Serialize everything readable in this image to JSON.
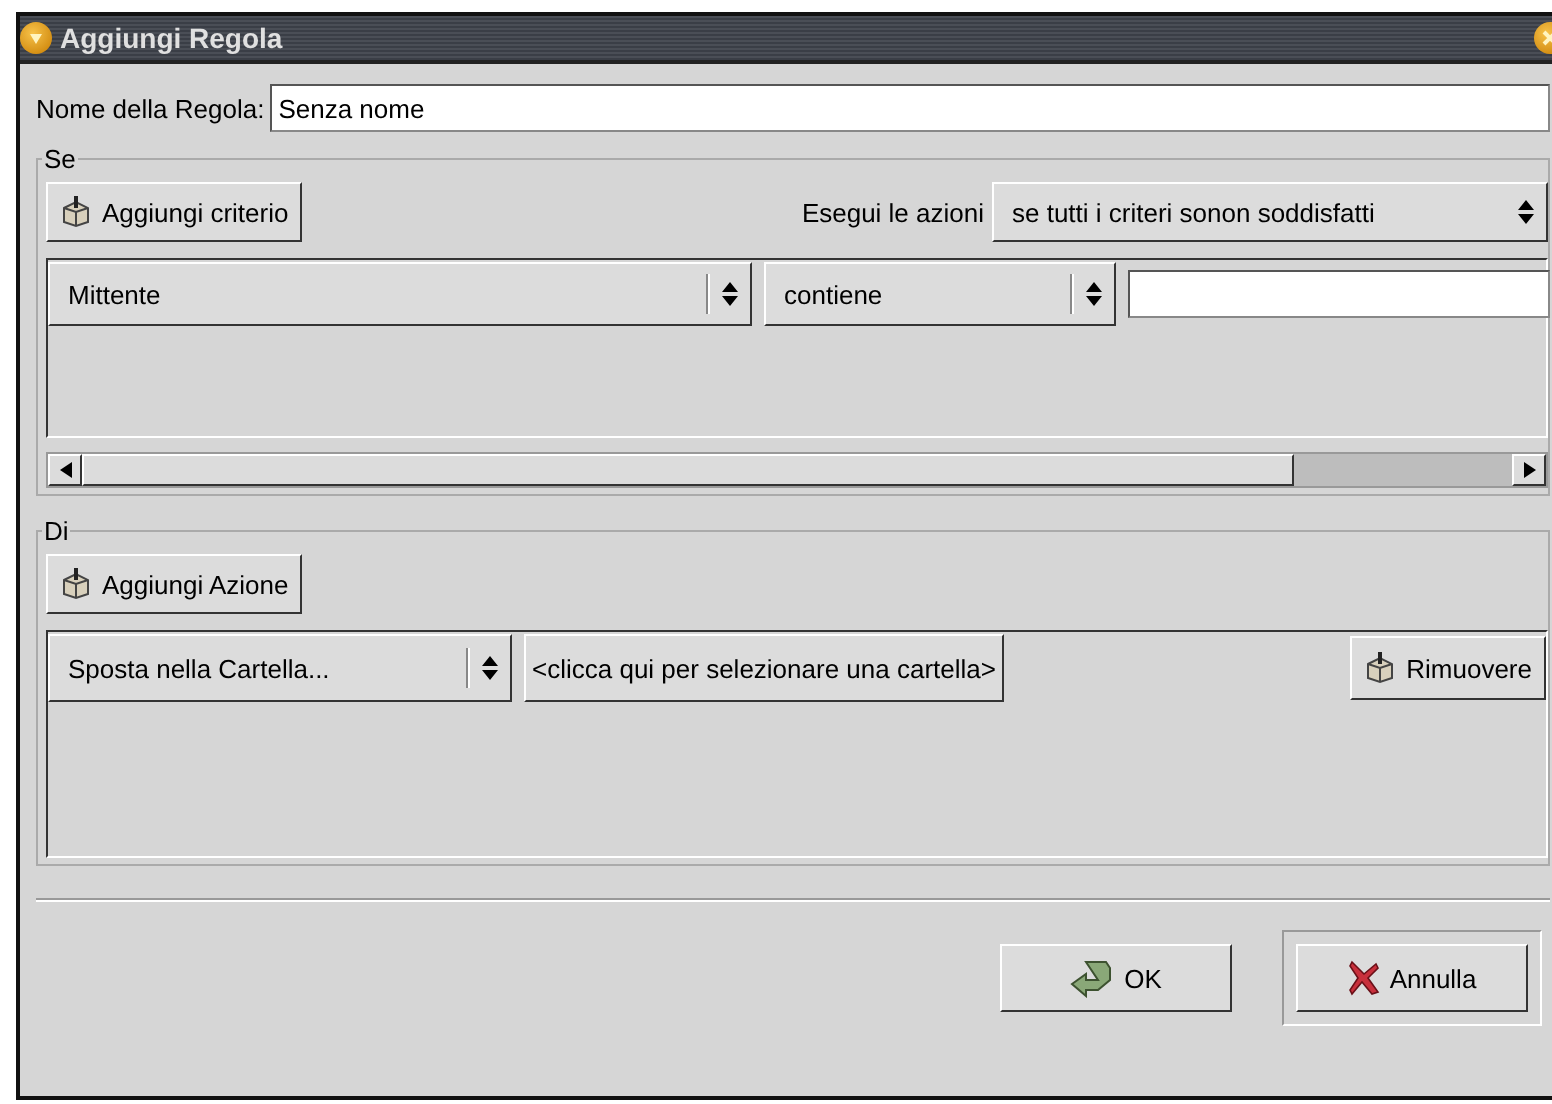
{
  "window": {
    "title": "Aggiungi Regola"
  },
  "rule_name": {
    "label": "Nome della Regola:",
    "value": "Senza nome"
  },
  "if_section": {
    "title": "Se",
    "add_button": "Aggiungi criterio",
    "execute_label": "Esegui le azioni",
    "execute_option": "se tutti i criteri sonon soddisfatti",
    "criteria": [
      {
        "field": "Mittente",
        "operator": "contiene"
      }
    ]
  },
  "do_section": {
    "title": "Di",
    "add_button": "Aggiungi Azione",
    "actions": [
      {
        "action": "Sposta nella Cartella...",
        "folder_button": "<clicca qui per selezionare una cartella>",
        "remove_button": "Rimuovere"
      }
    ]
  },
  "buttons": [
    {
      "kind": "ok",
      "label": "OK",
      "default": false
    },
    {
      "kind": "cancel",
      "label": "Annulla",
      "default": true
    }
  ]
}
